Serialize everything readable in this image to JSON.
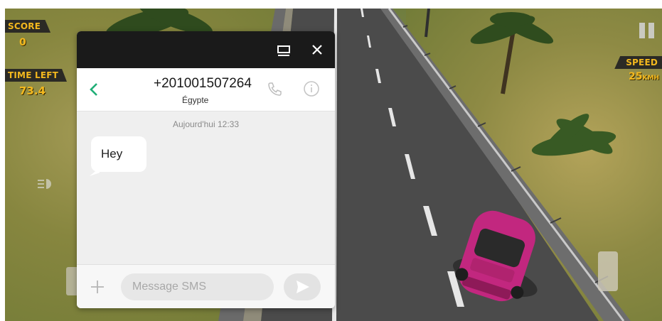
{
  "game": {
    "score_label": "SCORE",
    "score_value": "0",
    "time_left_label": "TIME LEFT",
    "time_left_value": "73.4",
    "speed_label": "SPEED",
    "speed_value": "25",
    "speed_unit": "KMH",
    "icons": [
      "pause-icon",
      "headlight-icon",
      "brake-pedal",
      "gas-pedal"
    ],
    "colors": {
      "hud_text": "#f3b81e",
      "hud_bg": "#2b2a25",
      "car": "#c2277f"
    }
  },
  "sms": {
    "titlebar_icons": [
      "minimize-icon",
      "close-icon"
    ],
    "contact_number": "+201001507264",
    "contact_country": "Égypte",
    "header_icons": [
      "back-icon",
      "phone-icon",
      "info-icon"
    ],
    "timestamp": "Aujourd'hui 12:33",
    "messages": [
      {
        "text": "Hey",
        "direction": "incoming"
      }
    ],
    "composer": {
      "placeholder": "Message SMS",
      "value": ""
    },
    "colors": {
      "accent": "#1fae76",
      "titlebar": "#1a1a1a"
    }
  }
}
